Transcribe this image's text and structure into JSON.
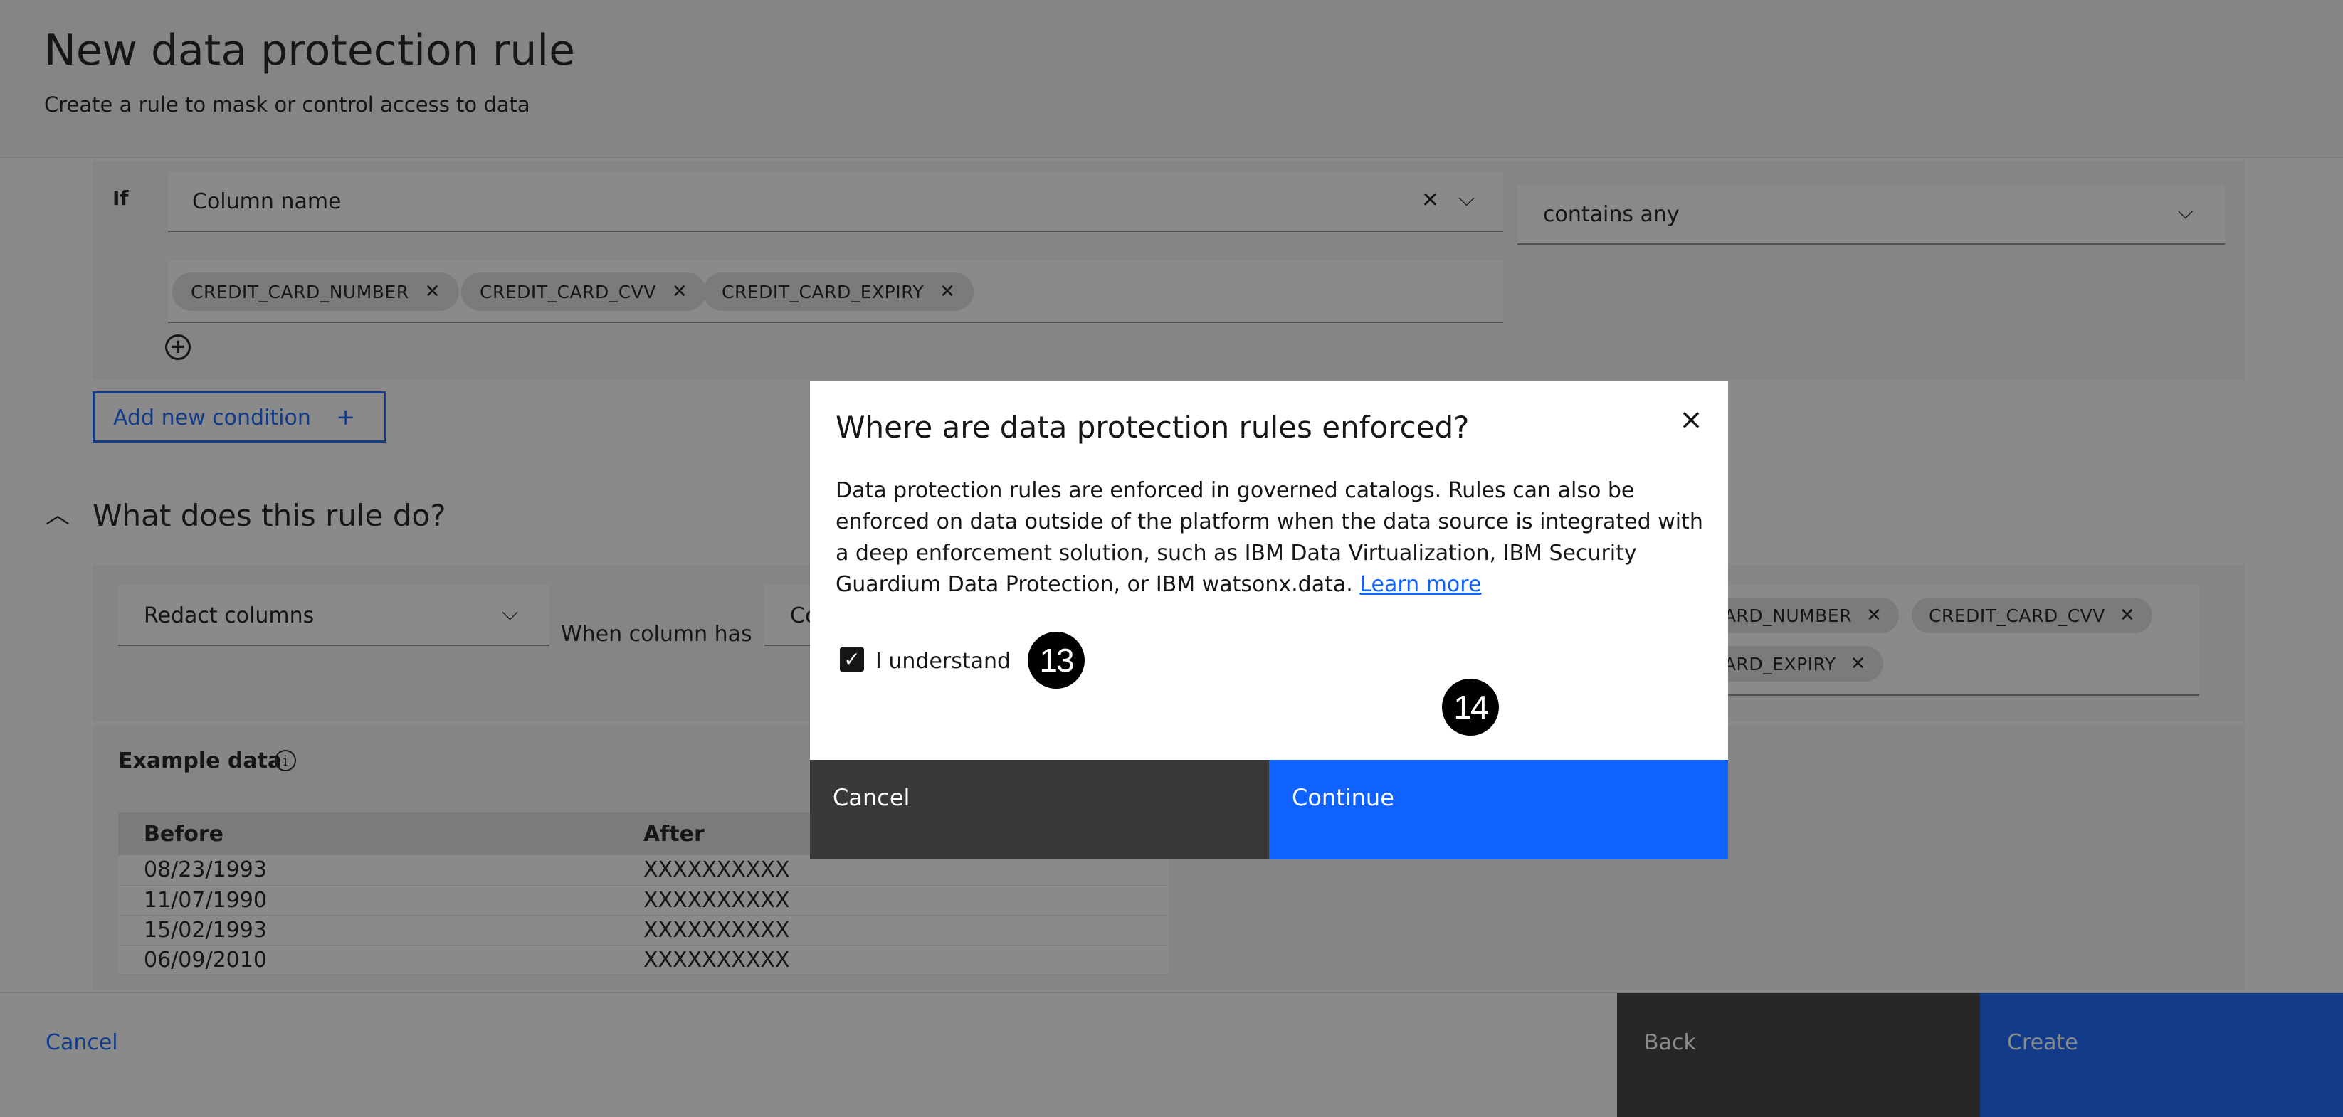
{
  "header": {
    "title": "New data protection rule",
    "subtitle": "Create a rule to mask or control access to data"
  },
  "condition": {
    "if_label": "If",
    "field_value": "Column name",
    "operator_value": "contains any",
    "tags": [
      "CREDIT_CARD_NUMBER",
      "CREDIT_CARD_CVV",
      "CREDIT_CARD_EXPIRY"
    ],
    "add_condition_label": "Add new condition"
  },
  "action_section": {
    "title": "What does this rule do?",
    "action_value": "Redact columns",
    "when_label": "When column has",
    "criteria_value_partial": "Co",
    "tags_visible": [
      "CARD_NUMBER",
      "CREDIT_CARD_CVV",
      "CARD_EXPIRY"
    ]
  },
  "example": {
    "label": "Example data",
    "columns": [
      "Before",
      "After"
    ],
    "rows": [
      [
        "08/23/1993",
        "XXXXXXXXXX"
      ],
      [
        "11/07/1990",
        "XXXXXXXXXX"
      ],
      [
        "15/02/1993",
        "XXXXXXXXXX"
      ],
      [
        "06/09/2010",
        "XXXXXXXXXX"
      ]
    ]
  },
  "footer": {
    "cancel_label": "Cancel",
    "back_label": "Back",
    "create_label": "Create"
  },
  "modal": {
    "title": "Where are data protection rules enforced?",
    "body": "Data protection rules are enforced in governed catalogs. Rules can also be enforced on data outside of the platform when the data source is integrated with a deep enforcement solution, such as IBM Data Virtualization, IBM Security Guardium Data Protection, or IBM watsonx.data.",
    "learn_more": "Learn more",
    "checkbox_label": "I understand",
    "checkbox_checked": true,
    "cancel_label": "Cancel",
    "continue_label": "Continue"
  },
  "annotations": {
    "step13": "13",
    "step14": "14"
  },
  "colors": {
    "primary": "#0f62fe",
    "secondary_button": "#393939",
    "overlay": "rgba(22,22,22,0.5)"
  }
}
